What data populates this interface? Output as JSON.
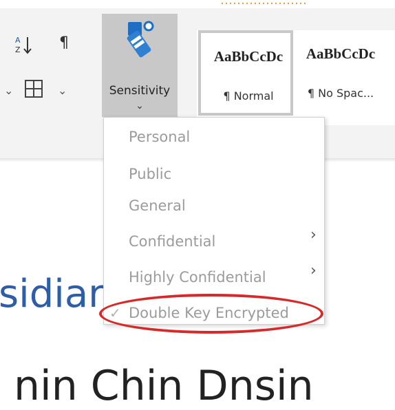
{
  "top_strip": {
    "text": "…………………"
  },
  "ribbon": {
    "sort_icon": "sort-az-icon",
    "pilcrow": "¶",
    "sensitivity": {
      "label": "Sensitivity",
      "icon": "sensitivity-label-icon"
    },
    "styles": [
      {
        "sample": "AaBbCcDc",
        "name": "¶ Normal",
        "selected": true
      },
      {
        "sample": "AaBbCcDc",
        "name": "¶ No Spac...",
        "selected": false
      }
    ]
  },
  "sensitivity_menu": {
    "items": [
      {
        "label": "Personal",
        "has_submenu": false
      },
      {
        "label": "Public",
        "has_submenu": false
      },
      {
        "label": "General",
        "has_submenu": false
      },
      {
        "label": "Confidential",
        "has_submenu": true
      },
      {
        "label": "Highly Confidential",
        "has_submenu": true
      },
      {
        "label": "Double Key Encrypted",
        "has_submenu": false,
        "checked": true,
        "highlighted": true
      }
    ]
  },
  "document": {
    "heading1": "sidiar",
    "heading2": "nin Chin Dnsin"
  },
  "colors": {
    "ribbon_bg": "#f3f3f3",
    "sensitivity_pressed": "#c8c8c8",
    "menu_text": "#9b9b9b",
    "heading_blue": "#2e5ea8",
    "highlight_red": "#d62a2a"
  }
}
